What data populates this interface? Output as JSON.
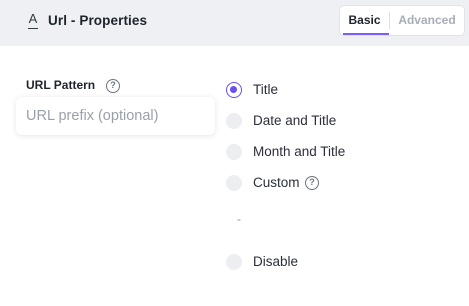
{
  "header": {
    "icon": "text-format-icon",
    "icon_glyph": "A",
    "title": "Url - Properties",
    "tabs": [
      {
        "label": "Basic",
        "active": true
      },
      {
        "label": "Advanced",
        "active": false
      }
    ]
  },
  "url_pattern": {
    "label": "URL Pattern",
    "help_glyph": "?",
    "input_value": "",
    "input_placeholder": "URL prefix (optional)"
  },
  "options": [
    {
      "label": "Title",
      "checked": true
    },
    {
      "label": "Date and Title",
      "checked": false
    },
    {
      "label": "Month and Title",
      "checked": false
    },
    {
      "label": "Custom",
      "checked": false,
      "help": true
    },
    {
      "label": "Disable",
      "checked": false
    }
  ],
  "custom_preview": "-",
  "colors": {
    "accent": "#6c4ff0",
    "header_bg": "#eef0f3",
    "muted_text": "#a7adb8"
  }
}
